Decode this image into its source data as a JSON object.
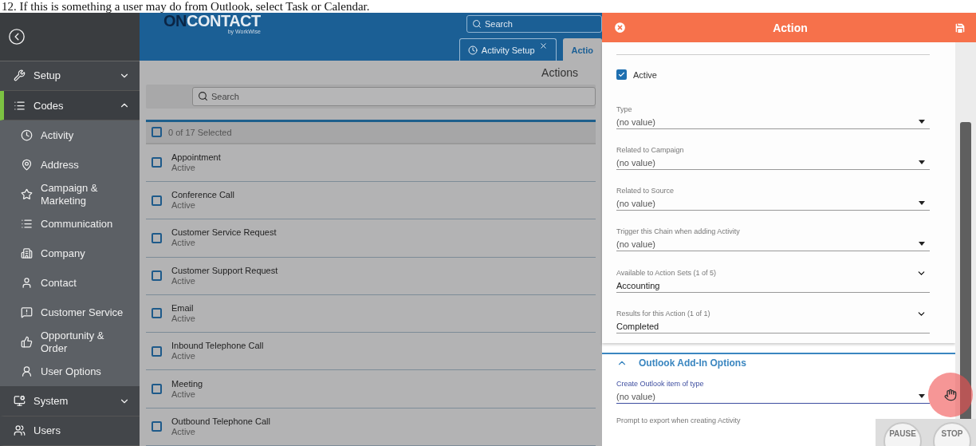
{
  "caption": "12. If this is something a user may do from Outlook, select Task or Calendar.",
  "sidebar": {
    "items": [
      {
        "label": "Setup",
        "kind": "group",
        "expanded": false,
        "selected": false
      },
      {
        "label": "Codes",
        "kind": "group",
        "expanded": true,
        "selected": true,
        "children": [
          {
            "label": "Activity"
          },
          {
            "label": "Address"
          },
          {
            "label": "Campaign & Marketing"
          },
          {
            "label": "Communication"
          },
          {
            "label": "Company"
          },
          {
            "label": "Contact"
          },
          {
            "label": "Customer Service"
          },
          {
            "label": "Opportunity & Order"
          },
          {
            "label": "User Options"
          }
        ]
      },
      {
        "label": "System",
        "kind": "group",
        "expanded": false,
        "selected": false
      },
      {
        "label": "Users",
        "kind": "link"
      }
    ]
  },
  "header": {
    "logo_strong": "ON",
    "logo_rest": "CONTACT",
    "logo_sub": "by WorkWise",
    "search": {
      "placeholder": "Search"
    },
    "tabs": [
      {
        "label": "Activity Setup",
        "selected": false,
        "closable": true
      },
      {
        "label": "Actio",
        "selected": true,
        "closable": false
      }
    ]
  },
  "list": {
    "title": "Actions",
    "search": {
      "placeholder": "Search"
    },
    "selection": "0 of 17 Selected",
    "all_checked": false,
    "rows": [
      {
        "name": "Appointment",
        "status": "Active",
        "checked": false
      },
      {
        "name": "Conference Call",
        "status": "Active",
        "checked": false
      },
      {
        "name": "Customer Service Request",
        "status": "Active",
        "checked": false
      },
      {
        "name": "Customer Support Request",
        "status": "Active",
        "checked": false
      },
      {
        "name": "Email",
        "status": "Active",
        "checked": false
      },
      {
        "name": "Inbound Telephone Call",
        "status": "Active",
        "checked": false
      },
      {
        "name": "Meeting",
        "status": "Active",
        "checked": false
      },
      {
        "name": "Outbound Telephone Call",
        "status": "Active",
        "checked": false
      }
    ]
  },
  "panel": {
    "title": "Action",
    "active": {
      "label": "Active",
      "checked": true
    },
    "fields": [
      {
        "label": "Type",
        "value": "(no value)",
        "kind": "select"
      },
      {
        "label": "Related to Campaign",
        "value": "(no value)",
        "kind": "select"
      },
      {
        "label": "Related to Source",
        "value": "(no value)",
        "kind": "select"
      },
      {
        "label": "Trigger this Chain when adding Activity",
        "value": "(no value)",
        "kind": "select"
      },
      {
        "label": "Available to Action Sets (1 of 5)",
        "value": "Accounting",
        "kind": "multi"
      },
      {
        "label": "Results for this Action (1 of 1)",
        "value": "Completed",
        "kind": "multi"
      }
    ],
    "section": {
      "title": "Outlook Add-In Options",
      "expanded": true,
      "fields": [
        {
          "label": "Create Outlook item of type",
          "value": "(no value)",
          "kind": "select",
          "focused": true
        },
        {
          "label": "Prompt to export when creating Activity",
          "kind": "label"
        }
      ]
    }
  },
  "recorder": {
    "buttons": [
      "PAUSE",
      "STOP"
    ]
  }
}
